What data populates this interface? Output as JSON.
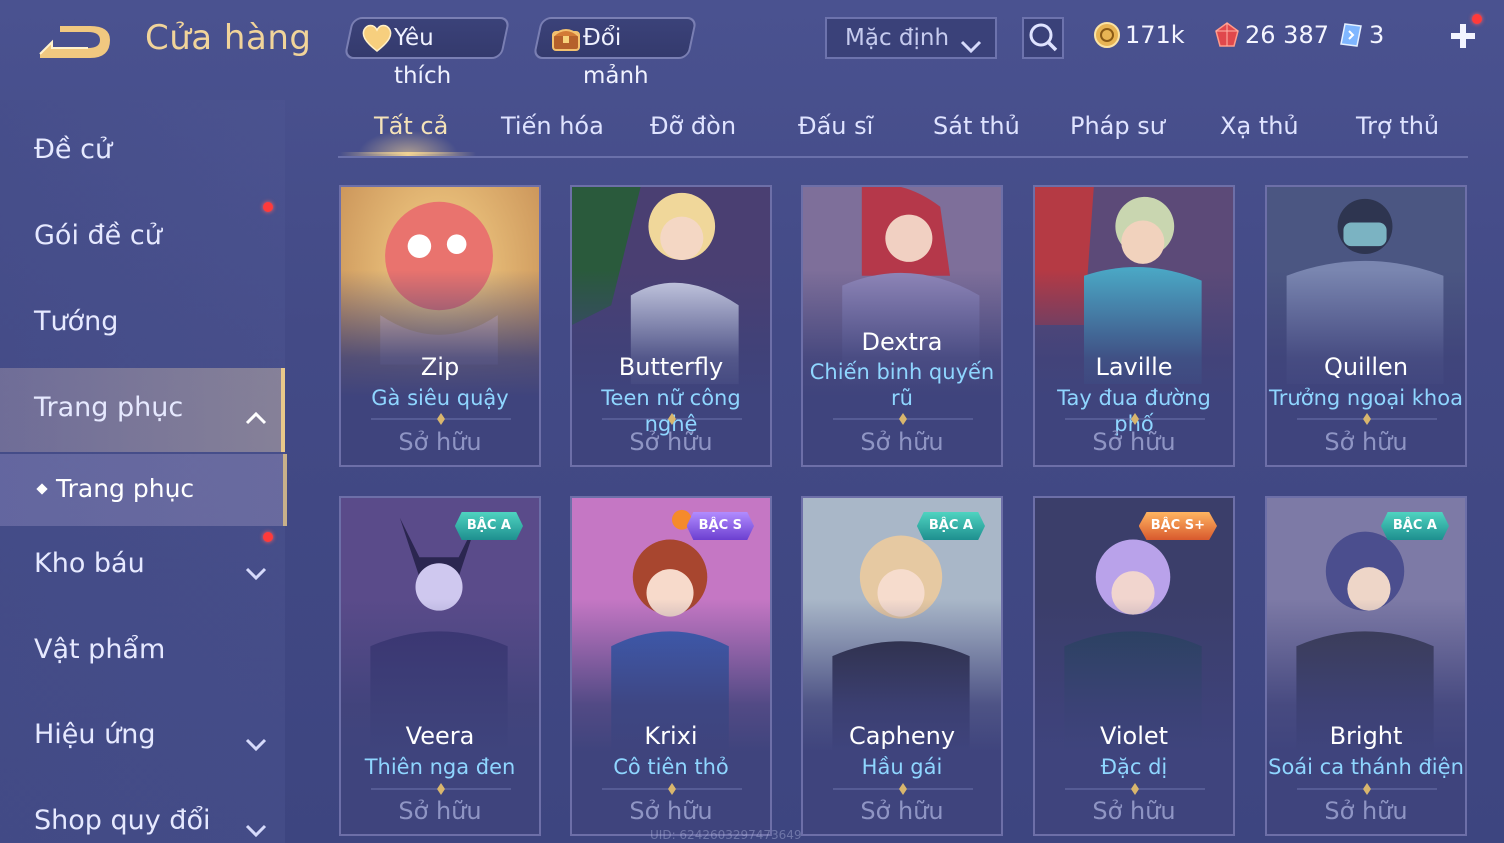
{
  "header": {
    "title": "Cửa hàng",
    "favorites_label": "Yêu thích",
    "shards_label": "Đổi mảnh",
    "sort_selected": "Mặc định",
    "gold": "171k",
    "rubies": "26 387",
    "vouchers": "3"
  },
  "sidebar": {
    "items": [
      {
        "label": "Đề cử"
      },
      {
        "label": "Gói đề cử"
      },
      {
        "label": "Tướng"
      },
      {
        "label": "Trang phục"
      },
      {
        "label": "Kho báu"
      },
      {
        "label": "Vật phẩm"
      },
      {
        "label": "Hiệu ứng"
      },
      {
        "label": "Shop quy đổi"
      }
    ],
    "subitem": "Trang phục"
  },
  "tabs": [
    "Tất cả",
    "Tiến hóa",
    "Đỡ đòn",
    "Đấu sĩ",
    "Sát thủ",
    "Pháp sư",
    "Xạ thủ",
    "Trợ thủ"
  ],
  "cards": [
    {
      "hero": "Zip",
      "skin": "Gà siêu quậy",
      "status": "Sở hữu",
      "badge": ""
    },
    {
      "hero": "Butterfly",
      "skin": "Teen nữ công nghệ",
      "status": "Sở hữu",
      "badge": ""
    },
    {
      "hero": "Dextra",
      "skin": "Chiến binh quyến rũ",
      "status": "Sở hữu",
      "badge": ""
    },
    {
      "hero": "Laville",
      "skin": "Tay đua đường phố",
      "status": "Sở hữu",
      "badge": ""
    },
    {
      "hero": "Quillen",
      "skin": "Trưởng ngoại khoa",
      "status": "Sở hữu",
      "badge": ""
    },
    {
      "hero": "Veera",
      "skin": "Thiên nga đen",
      "status": "Sở hữu",
      "badge": "BẬC A"
    },
    {
      "hero": "Krixi",
      "skin": "Cô tiên thỏ",
      "status": "Sở hữu",
      "badge": "BẬC S"
    },
    {
      "hero": "Capheny",
      "skin": "Hầu gái",
      "status": "Sở hữu",
      "badge": "BẬC A"
    },
    {
      "hero": "Violet",
      "skin": "Đặc dị",
      "status": "Sở hữu",
      "badge": "BẬC S+"
    },
    {
      "hero": "Bright",
      "skin": "Soái ca thánh điện",
      "status": "Sở hữu",
      "badge": "BẬC A"
    }
  ],
  "footer": {
    "uid": "UID: 6242603297473649"
  },
  "colors": {
    "accent_gold": "#f1d49a",
    "skin_name": "#8fd6ff",
    "owned": "#8f95c4",
    "badge_a": "#1e8f8f",
    "badge_s": "#6c3fd0",
    "badge_splus": "#d8592d"
  }
}
